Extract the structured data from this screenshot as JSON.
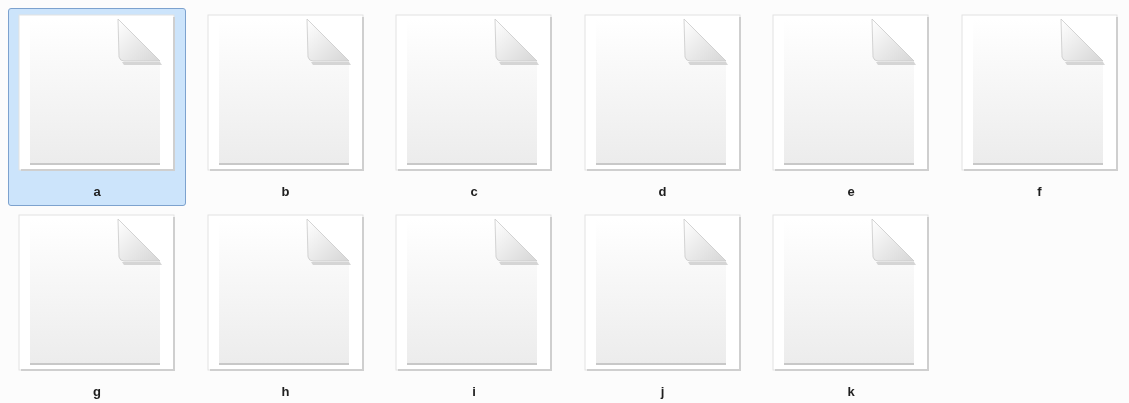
{
  "files": [
    {
      "name": "a",
      "selected": true
    },
    {
      "name": "b",
      "selected": false
    },
    {
      "name": "c",
      "selected": false
    },
    {
      "name": "d",
      "selected": false
    },
    {
      "name": "e",
      "selected": false
    },
    {
      "name": "f",
      "selected": false
    },
    {
      "name": "g",
      "selected": false
    },
    {
      "name": "h",
      "selected": false
    },
    {
      "name": "i",
      "selected": false
    },
    {
      "name": "j",
      "selected": false
    },
    {
      "name": "k",
      "selected": false
    }
  ]
}
